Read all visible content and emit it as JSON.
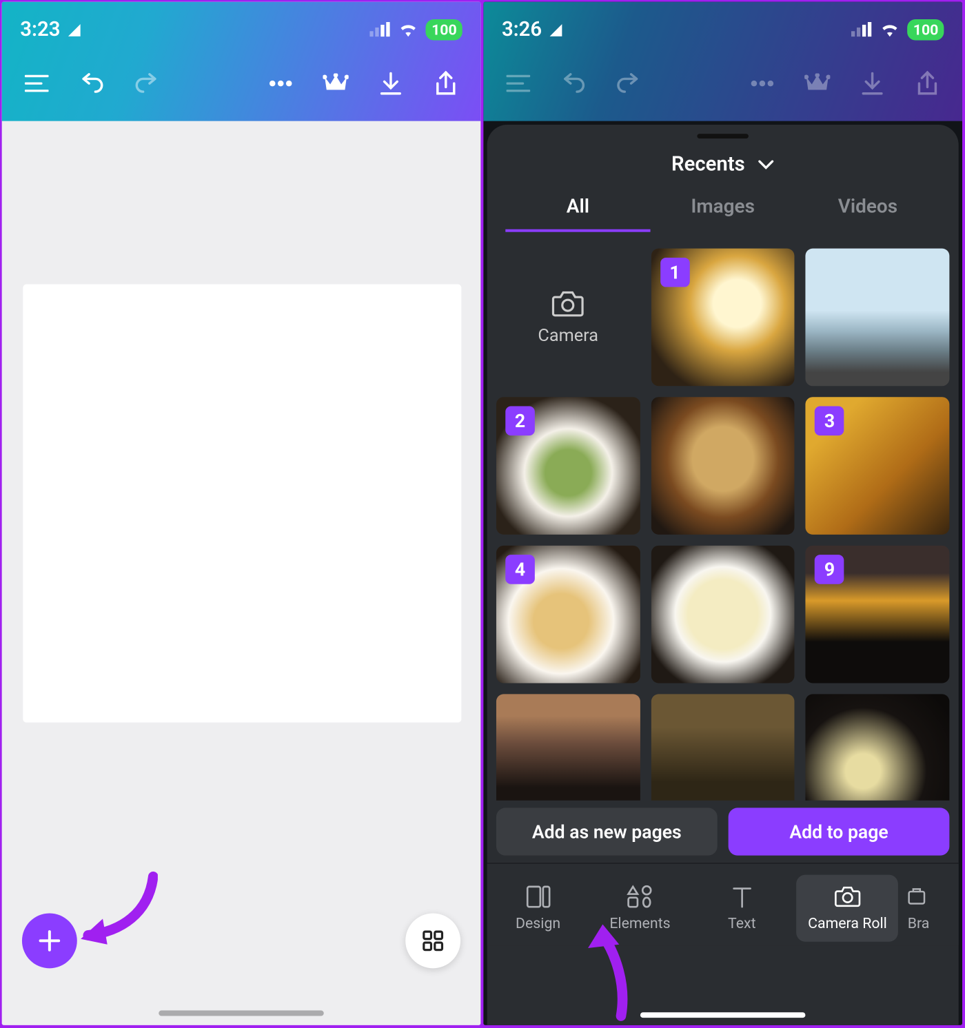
{
  "left": {
    "time": "3:23",
    "battery": "100"
  },
  "right": {
    "time": "3:26",
    "battery": "100",
    "header": "Recents",
    "tabs": {
      "all": "All",
      "images": "Images",
      "videos": "Videos"
    },
    "camera_label": "Camera",
    "selected_badges": [
      "1",
      "2",
      "3",
      "4",
      "9"
    ],
    "btn_new_pages": "Add as new pages",
    "btn_add_page": "Add to page",
    "bottom_tabs": {
      "design": "Design",
      "elements": "Elements",
      "text": "Text",
      "camera_roll": "Camera Roll",
      "brand": "Bra"
    }
  }
}
